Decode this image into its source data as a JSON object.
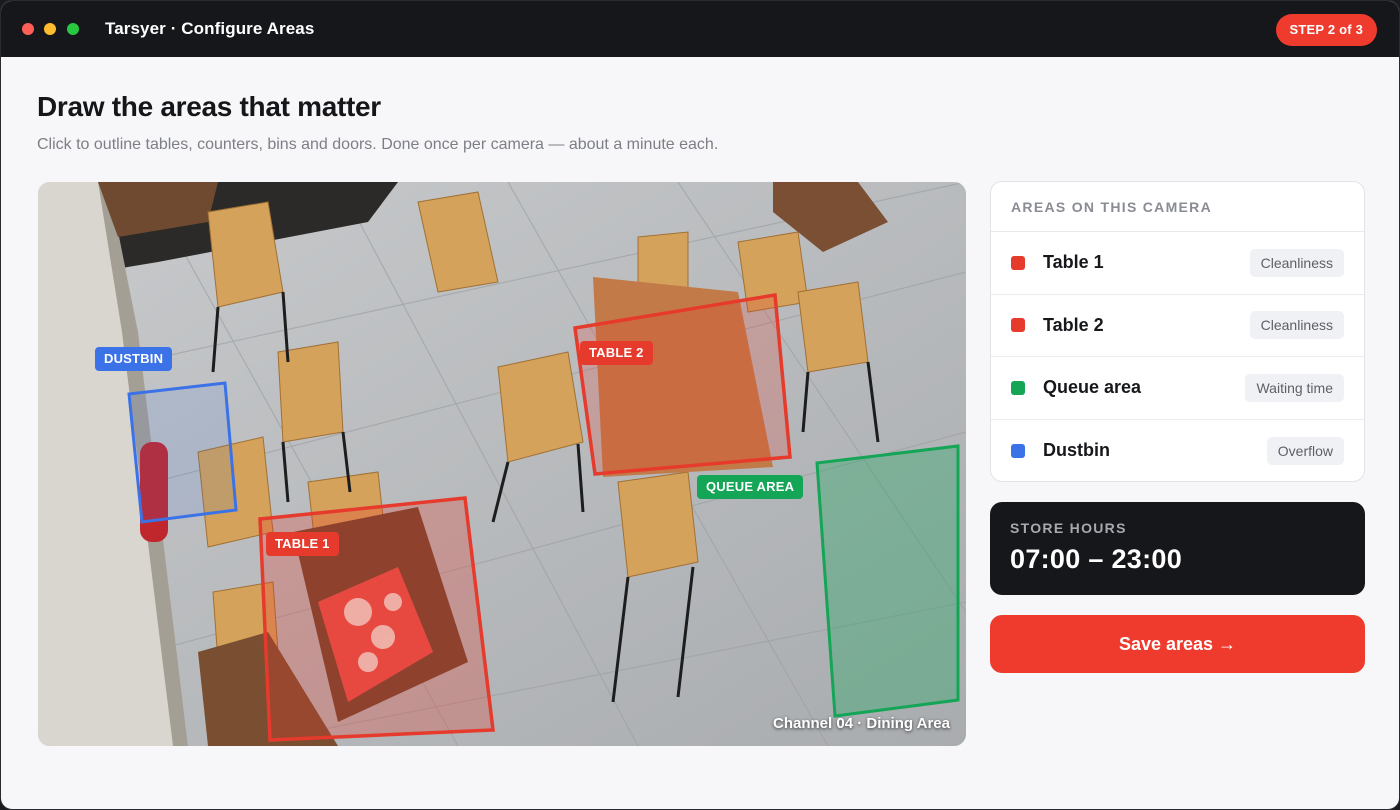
{
  "titlebar": {
    "title": "Tarsyer · Configure Areas",
    "step": "STEP 2 of 3"
  },
  "header": {
    "title": "Draw the areas that matter",
    "subtitle": "Click to outline tables, counters, bins and doors. Done once per camera — about a minute each."
  },
  "camera": {
    "channel_label": "Channel 04 · Dining Area",
    "overlays": {
      "dustbin": "DUSTBIN",
      "table2": "TABLE 2",
      "queue": "QUEUE AREA",
      "table1": "TABLE 1"
    }
  },
  "areas_panel": {
    "title": "AREAS ON THIS CAMERA",
    "items": [
      {
        "name": "Table 1",
        "tag": "Cleanliness",
        "color": "#e63a2c"
      },
      {
        "name": "Table 2",
        "tag": "Cleanliness",
        "color": "#e63a2c"
      },
      {
        "name": "Queue area",
        "tag": "Waiting time",
        "color": "#14a557"
      },
      {
        "name": "Dustbin",
        "tag": "Overflow",
        "color": "#3b72e8"
      }
    ]
  },
  "store_hours": {
    "label": "STORE HOURS",
    "value": "07:00 – 23:00"
  },
  "actions": {
    "save_label": "Save areas →"
  },
  "colors": {
    "accent": "#ef3b2d",
    "table": "#e63a2c",
    "queue": "#14a557",
    "dustbin": "#3b72e8",
    "dark": "#16171b"
  }
}
